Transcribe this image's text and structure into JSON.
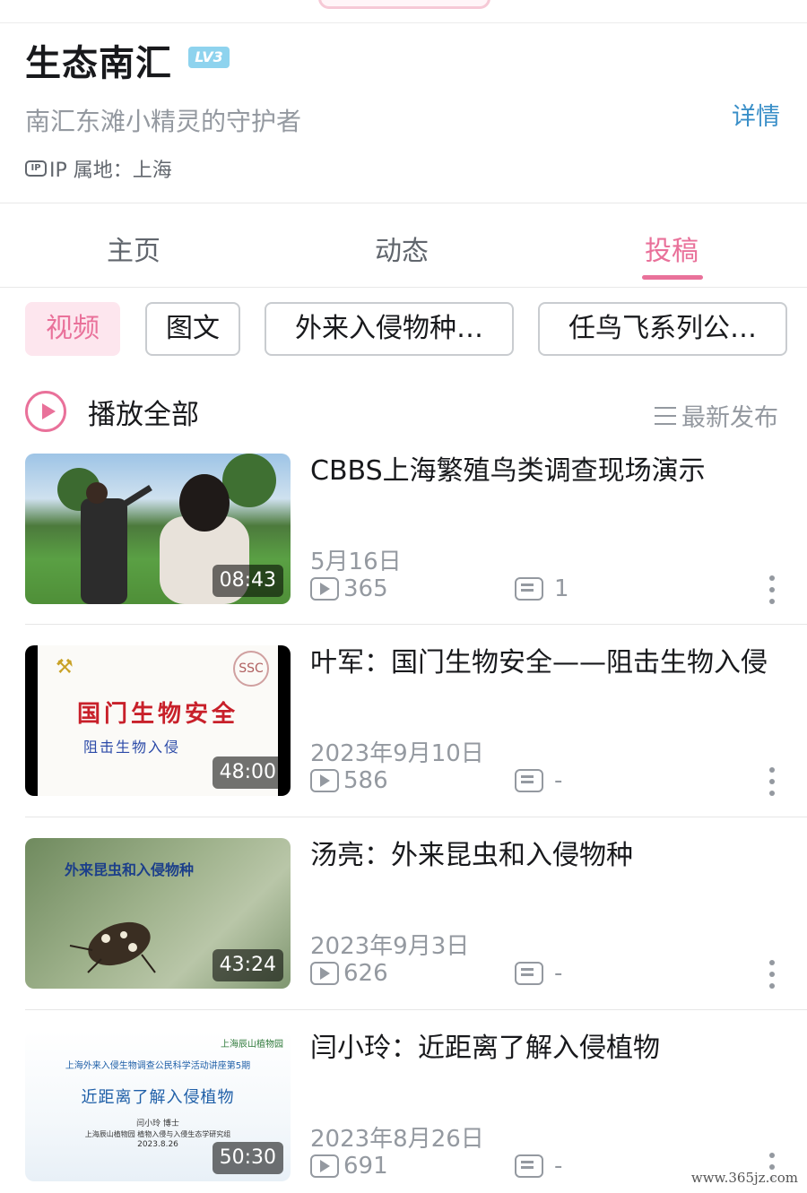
{
  "profile": {
    "name": "生态南汇",
    "level": "LV3",
    "signature": "南汇东滩小精灵的守护者",
    "detail_link": "详情",
    "ip_label": "IP 属地：上海",
    "ip_icon_text": "IP"
  },
  "tabs": [
    {
      "label": "主页",
      "active": false
    },
    {
      "label": "动态",
      "active": false
    },
    {
      "label": "投稿",
      "active": true
    }
  ],
  "filters": [
    {
      "label": "视频",
      "active": true
    },
    {
      "label": "图文",
      "active": false
    },
    {
      "label": "外来入侵物种…",
      "active": false
    },
    {
      "label": "任鸟飞系列公…",
      "active": false
    }
  ],
  "list_header": {
    "play_all": "播放全部",
    "sort": "最新发布"
  },
  "videos": [
    {
      "title": "CBBS上海繁殖鸟类调查现场演示",
      "date": "5月16日",
      "plays": "365",
      "comments": "1",
      "duration": "08:43"
    },
    {
      "title": "叶军：国门生物安全——阻击生物入侵",
      "date": "2023年9月10日",
      "plays": "586",
      "comments": "-",
      "duration": "48:00",
      "thumb_title": "国门生物安全",
      "thumb_subtitle": "阻击生物入侵"
    },
    {
      "title": "汤亮：外来昆虫和入侵物种",
      "date": "2023年9月3日",
      "plays": "626",
      "comments": "-",
      "duration": "43:24",
      "thumb_title": "外来昆虫和入侵物种"
    },
    {
      "title": "闫小玲：近距离了解入侵植物",
      "date": "2023年8月26日",
      "plays": "691",
      "comments": "-",
      "duration": "50:30",
      "thumb_header": "上海外来入侵生物调查公民科学活动讲座第5期",
      "thumb_logo": "上海辰山植物园",
      "thumb_title": "近距离了解入侵植物",
      "thumb_speaker": "闫小玲 博士",
      "thumb_org": "上海辰山植物园 植物入侵与入侵生态学研究组",
      "thumb_date": "2023.8.26"
    }
  ],
  "watermark": "www.365jz.com",
  "colors": {
    "accent": "#e9719a",
    "link": "#3a8fc8",
    "level_badge": "#8ed3ee",
    "muted_text": "#9499a0"
  }
}
